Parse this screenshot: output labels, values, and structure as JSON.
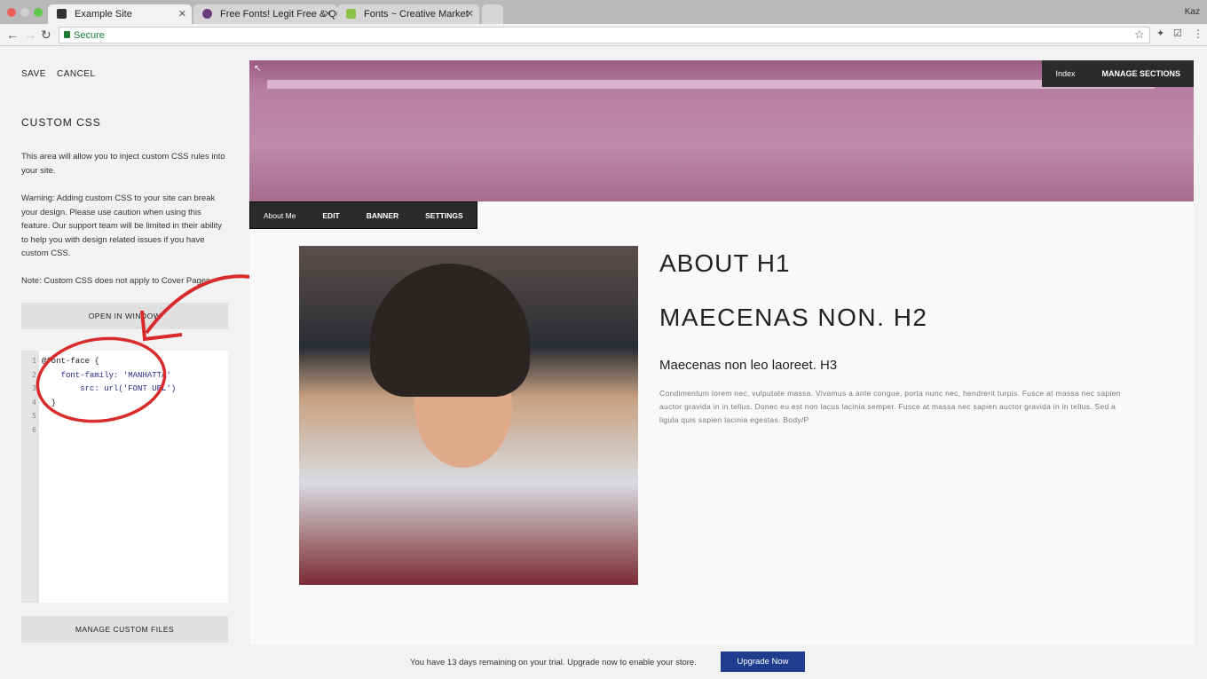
{
  "browser": {
    "tabs": [
      {
        "label": "Example Site",
        "favicon_color": "#333333"
      },
      {
        "label": "Free Fonts! Legit Free & Quali",
        "favicon_color": "#6a3a7a"
      },
      {
        "label": "Fonts ~ Creative Market",
        "favicon_color": "#8bc34a"
      }
    ],
    "user": "Kaz",
    "secure_label": "Secure"
  },
  "sidebar": {
    "save": "SAVE",
    "cancel": "CANCEL",
    "title": "CUSTOM CSS",
    "p1": "This area will allow you to inject custom CSS rules into your site.",
    "p2": "Warning: Adding custom CSS to your site can break your design. Please use caution when using this feature. Our support team will be limited in their ability to help you with design related issues if you have custom CSS.",
    "p3": "Note: Custom CSS does not apply to Cover Pages.",
    "open_window": "OPEN IN WINDOW",
    "manage_files": "MANAGE CUSTOM FILES",
    "code_lines": [
      "@font-face {",
      "    font-family: 'MANHATTA'",
      "        src: url('FONT URL')",
      "  }",
      "",
      ""
    ],
    "line_numbers": [
      "1",
      "2",
      "3",
      "4",
      "5",
      "6"
    ]
  },
  "site": {
    "topnav": {
      "index": "Index",
      "manage": "MANAGE SECTIONS"
    },
    "editbar": {
      "page": "About Me",
      "edit": "EDIT",
      "banner": "BANNER",
      "settings": "SETTINGS"
    },
    "h1": "ABOUT H1",
    "h2": "MAECENAS NON. H2",
    "h3": "Maecenas non leo laoreet. H3",
    "body": "Condimentum lorem nec, vulputate massa. Vivamus a ante congue, porta nunc nec, hendrerit turpis. Fusce at massa nec sapien auctor gravida in in tellus. Donec eu est non lacus lacinia semper. Fusce at massa nec sapien auctor gravida in in tellus. Sed a ligula quis sapien lacinia egestas. Body/P"
  },
  "trial": {
    "text": "You have 13 days remaining on your trial. Upgrade now to enable your store.",
    "button": "Upgrade Now"
  },
  "colors": {
    "annotation": "#d92b2b",
    "upgrade": "#1f3d8f",
    "banner_tint": "#b77ea3"
  }
}
